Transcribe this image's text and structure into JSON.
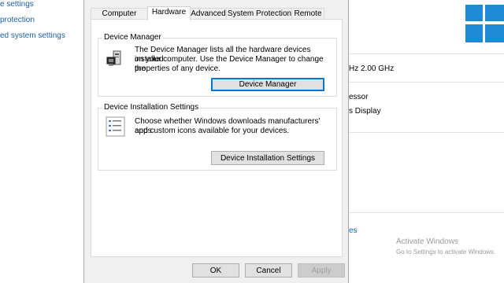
{
  "background": {
    "left_links": [
      "e settings",
      "protection",
      "ed system settings"
    ],
    "right_rows": [
      {
        "text": "Hz   2.00 GHz"
      },
      {
        "text": "essor"
      },
      {
        "text": "s Display"
      }
    ],
    "right_link": "es",
    "activate_title": "Activate Windows",
    "activate_sub": "Go to Settings to activate Windows."
  },
  "dialog": {
    "tabs": [
      "Computer Name",
      "Hardware",
      "Advanced",
      "System Protection",
      "Remote"
    ],
    "active_tab": "Hardware",
    "device_manager": {
      "title": "Device Manager",
      "line1": "The Device Manager lists all the hardware devices installed",
      "line2": "on your computer. Use the Device Manager to change the",
      "line3": "properties of any device.",
      "button": "Device Manager"
    },
    "device_installation": {
      "title": "Device Installation Settings",
      "line1": "Choose whether Windows downloads manufacturers' apps",
      "line2": "and custom icons available for your devices.",
      "button": "Device Installation Settings"
    },
    "footer": {
      "ok": "OK",
      "cancel": "Cancel",
      "apply": "Apply"
    }
  },
  "colors": {
    "accent": "#0078d7",
    "link": "#1a5fb4",
    "windows_logo": "#1e8ad6"
  }
}
